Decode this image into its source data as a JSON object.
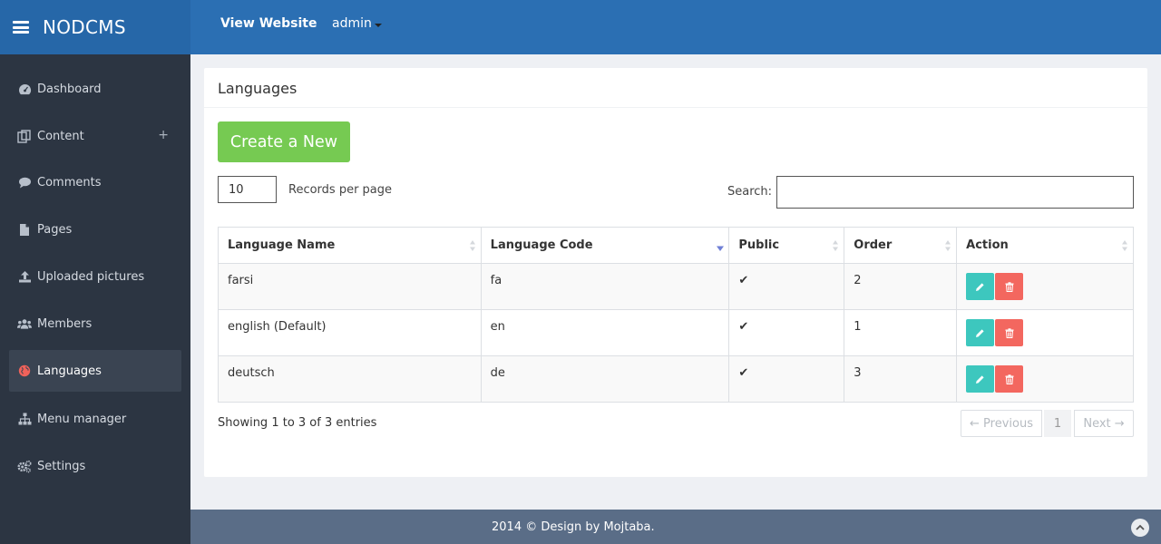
{
  "app": {
    "brand": "NODCMS"
  },
  "topnav": {
    "view_website": "View Website",
    "user": "admin"
  },
  "sidebar": {
    "items": [
      {
        "label": "Dashboard",
        "icon": "dashboard-icon"
      },
      {
        "label": "Content",
        "icon": "content-icon",
        "expand": "+"
      },
      {
        "label": "Comments",
        "icon": "comment-icon"
      },
      {
        "label": "Pages",
        "icon": "file-icon"
      },
      {
        "label": "Uploaded pictures",
        "icon": "upload-icon"
      },
      {
        "label": "Members",
        "icon": "users-icon"
      },
      {
        "label": "Languages",
        "icon": "globe-icon",
        "active": true
      },
      {
        "label": "Menu manager",
        "icon": "sitemap-icon"
      },
      {
        "label": "Settings",
        "icon": "gears-icon"
      }
    ]
  },
  "main": {
    "title": "Languages",
    "create_button": "Create a New",
    "records_per_page_value": "10",
    "records_per_page_label": "Records per page",
    "search_label": "Search:",
    "search_value": "",
    "table": {
      "columns": [
        "Language Name",
        "Language Code",
        "Public",
        "Order",
        "Action"
      ],
      "rows": [
        {
          "name": "farsi",
          "code": "fa",
          "public": "✔",
          "order": "2"
        },
        {
          "name": "english (Default)",
          "code": "en",
          "public": "✔",
          "order": "1"
        },
        {
          "name": "deutsch",
          "code": "de",
          "public": "✔",
          "order": "3"
        }
      ]
    },
    "info": "Showing 1 to 3 of 3 entries",
    "pagination": {
      "previous": "← Previous",
      "page": "1",
      "next": "Next →"
    }
  },
  "footer": {
    "text": "2014 © Design by Mojtaba."
  },
  "colors": {
    "topbar": "#2b6fb3",
    "sidebar": "#2c3542",
    "create_button": "#76ca52",
    "edit_button": "#3dc7be",
    "delete_button": "#f3675f",
    "footer": "#5a6d87",
    "active_icon": "#f0625a"
  }
}
